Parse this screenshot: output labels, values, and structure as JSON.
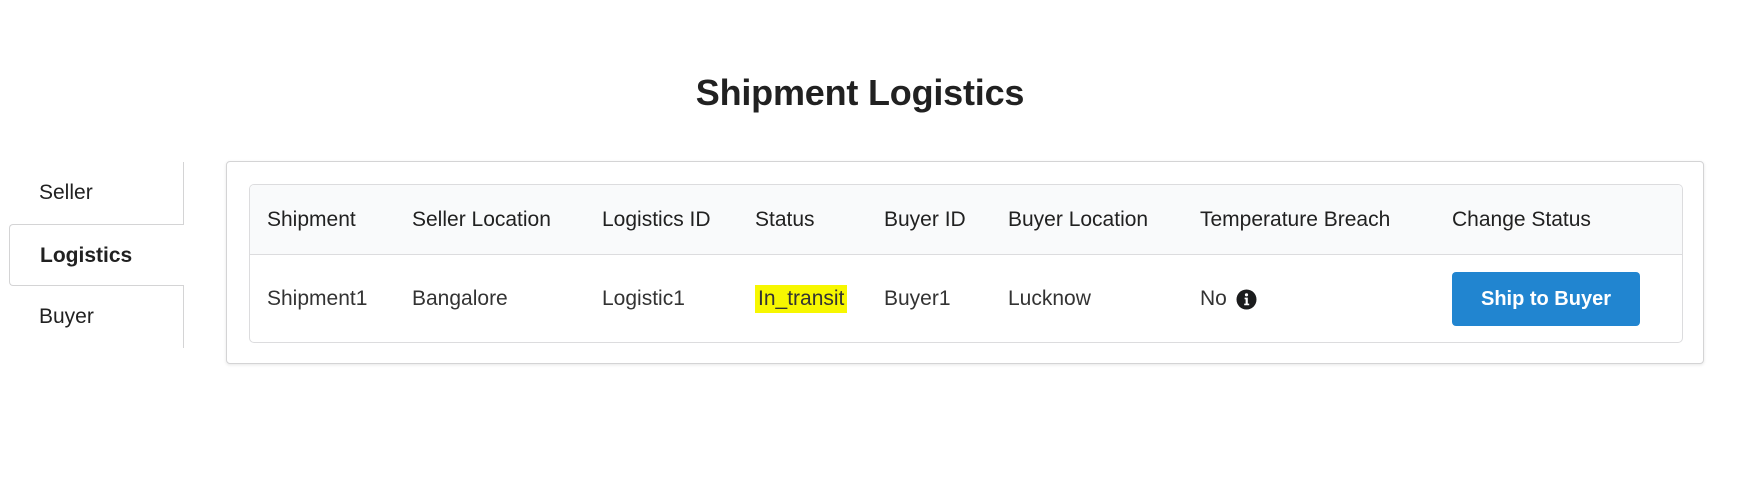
{
  "page": {
    "title": "Shipment Logistics"
  },
  "sidebar": {
    "items": [
      {
        "label": "Seller",
        "active": false
      },
      {
        "label": "Logistics",
        "active": true
      },
      {
        "label": "Buyer",
        "active": false
      }
    ]
  },
  "table": {
    "columns": [
      "Shipment",
      "Seller Location",
      "Logistics ID",
      "Status",
      "Buyer ID",
      "Buyer Location",
      "Temperature Breach",
      "Change Status"
    ],
    "rows": [
      {
        "shipment": "Shipment1",
        "seller_location": "Bangalore",
        "logistics_id": "Logistic1",
        "status": "In_transit",
        "buyer_id": "Buyer1",
        "buyer_location": "Lucknow",
        "temperature_breach": "No",
        "temperature_breach_icon": "info-circle-icon",
        "action_label": "Ship to Buyer"
      }
    ]
  },
  "colors": {
    "accent": "#2185d0",
    "status_highlight": "#f7f700"
  }
}
